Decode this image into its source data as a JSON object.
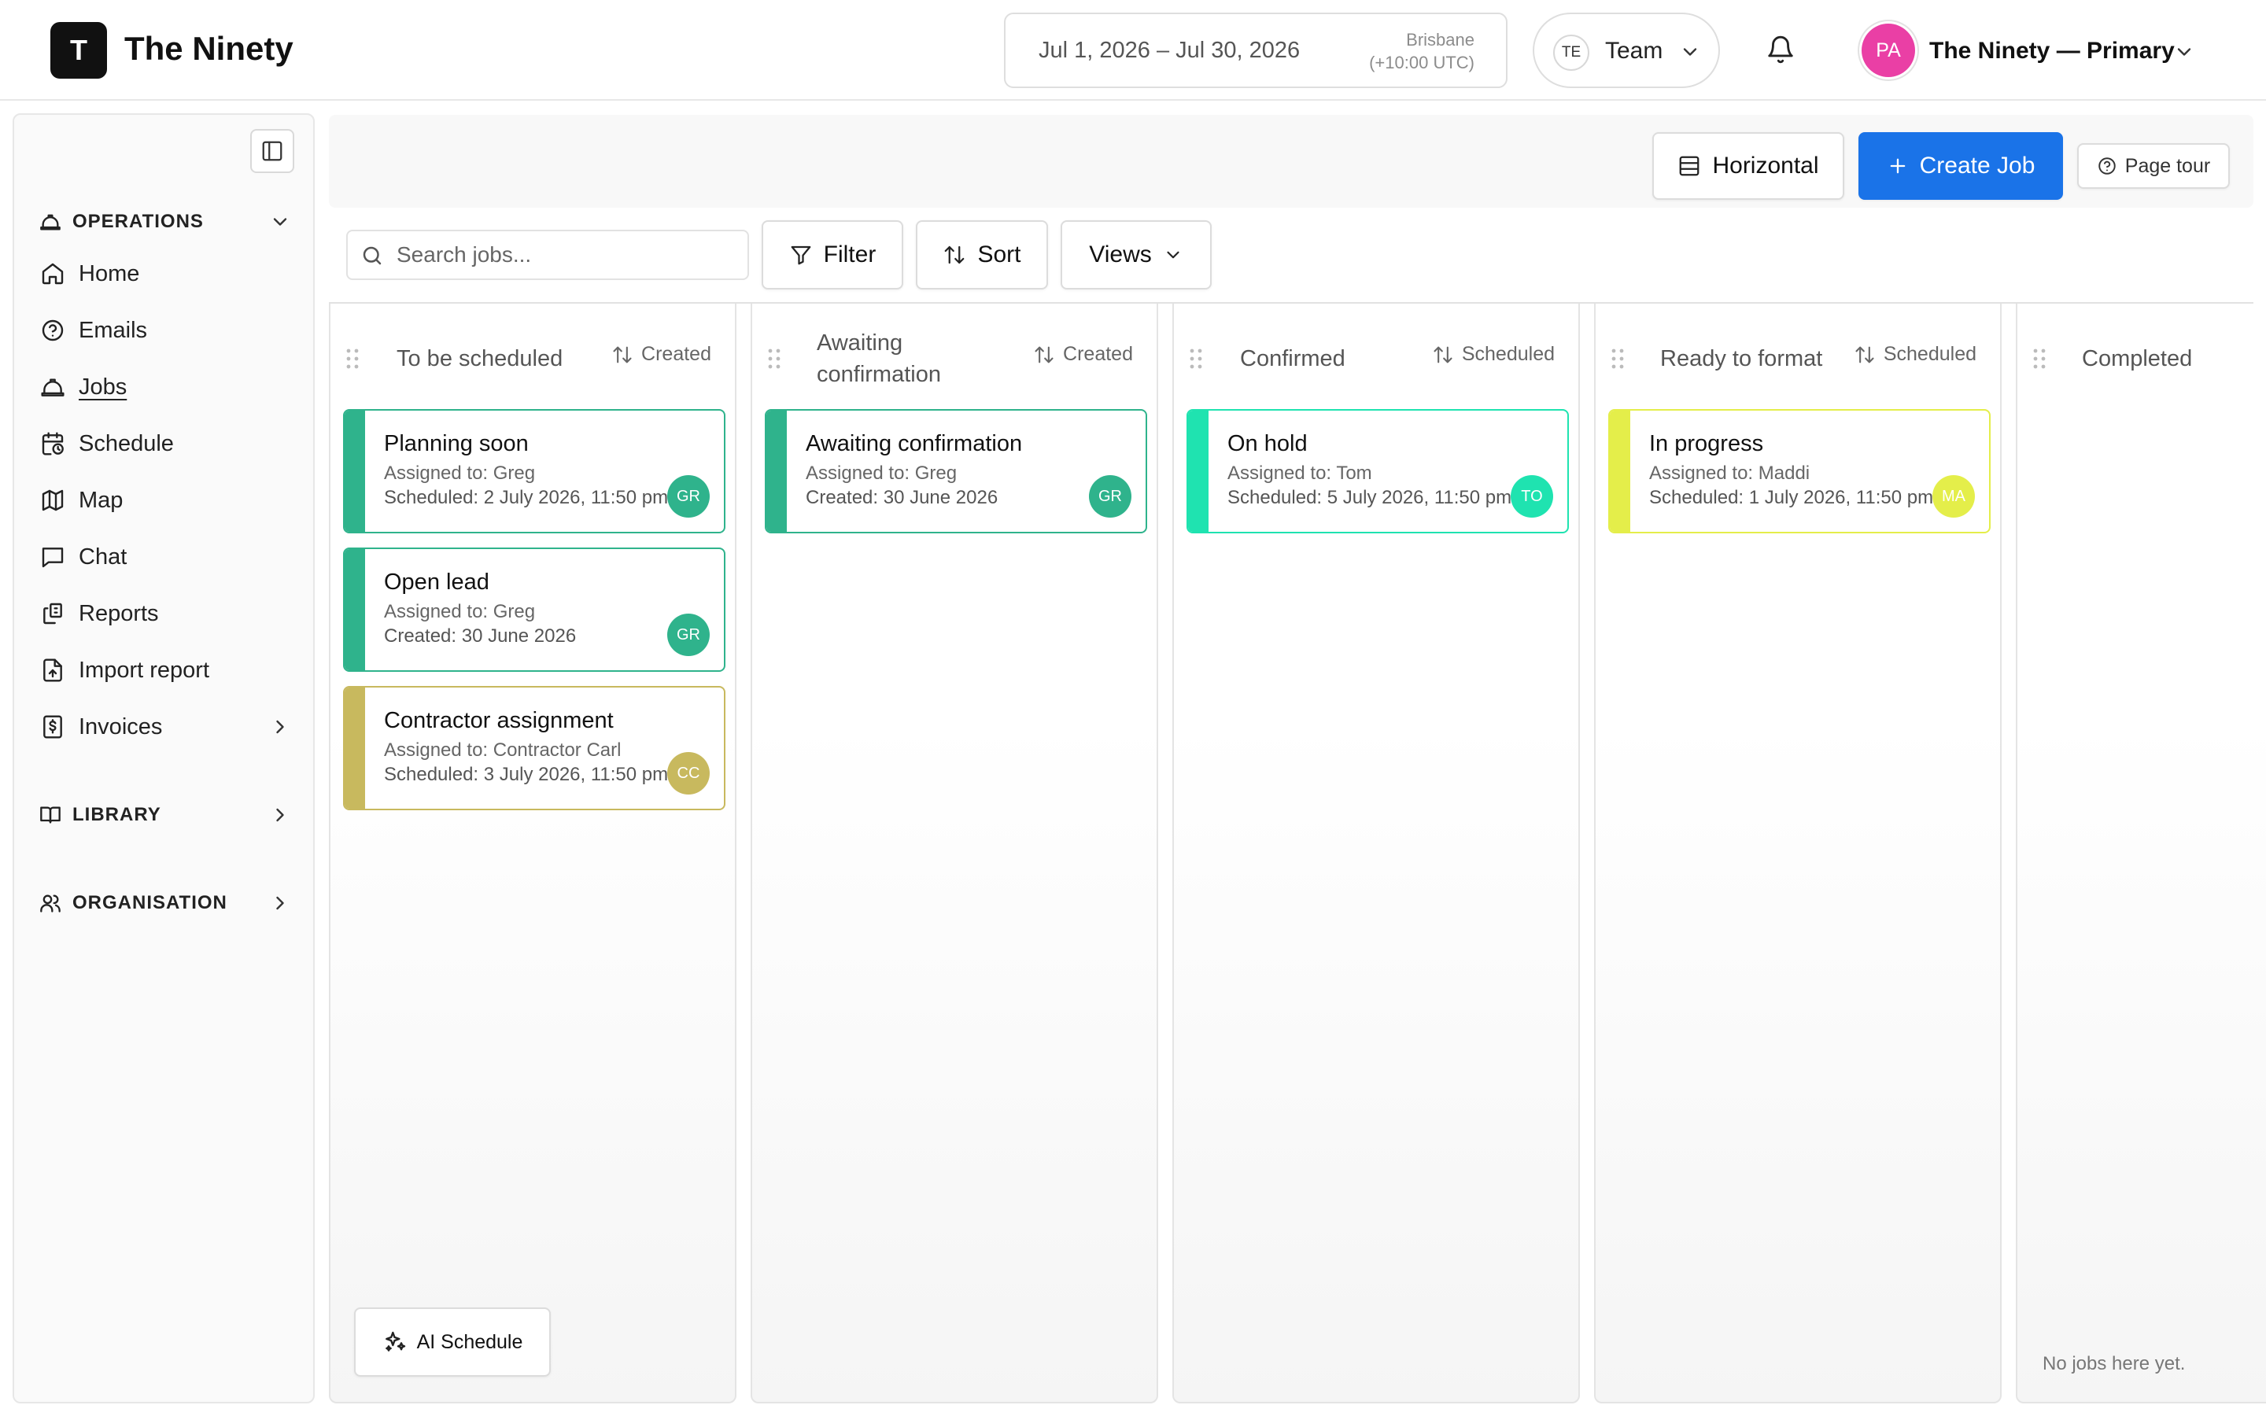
{
  "header": {
    "logo_letter": "T",
    "app_name": "The Ninety",
    "date_range": "Jul 1, 2026 – Jul 30, 2026",
    "timezone_city": "Brisbane",
    "timezone_offset": "(+10:00 UTC)",
    "team_initials": "TE",
    "team_label": "Team",
    "account_initials": "PA",
    "account_name": "The Ninety — Primary",
    "account_color": "#ea3fa5"
  },
  "sidebar": {
    "operations_label": "OPERATIONS",
    "items": [
      {
        "label": "Home",
        "icon": "home-icon"
      },
      {
        "label": "Emails",
        "icon": "help-circle-icon"
      },
      {
        "label": "Jobs",
        "icon": "hard-hat-icon"
      },
      {
        "label": "Schedule",
        "icon": "calendar-clock-icon"
      },
      {
        "label": "Map",
        "icon": "map-icon"
      },
      {
        "label": "Chat",
        "icon": "chat-icon"
      },
      {
        "label": "Reports",
        "icon": "reports-icon"
      },
      {
        "label": "Import report",
        "icon": "file-import-icon"
      },
      {
        "label": "Invoices",
        "icon": "invoice-icon"
      }
    ],
    "library_label": "LIBRARY",
    "organisation_label": "ORGANISATION"
  },
  "toolbar": {
    "horizontal_label": "Horizontal",
    "create_job_label": "Create Job",
    "page_tour_label": "Page tour",
    "search_placeholder": "Search jobs...",
    "filter_label": "Filter",
    "sort_label": "Sort",
    "views_label": "Views",
    "accent_color": "#1a73e8"
  },
  "columns": [
    {
      "title": "To be scheduled",
      "sort_label": "Created",
      "cards": [
        {
          "title": "Planning soon",
          "assigned": "Assigned to: Greg",
          "date": "Scheduled: 2 July 2026, 11:50 pm",
          "initials": "GR",
          "color": "#2fb38c"
        },
        {
          "title": "Open lead",
          "assigned": "Assigned to: Greg",
          "date": "Created: 30 June 2026",
          "initials": "GR",
          "color": "#2fb38c"
        },
        {
          "title": "Contractor assignment",
          "assigned": "Assigned to: Contractor Carl",
          "date": "Scheduled: 3 July 2026, 11:50 pm",
          "initials": "CC",
          "color": "#c8b95e"
        }
      ]
    },
    {
      "title": "Awaiting confirmation",
      "title_line1": "Awaiting",
      "title_line2": "confirmation",
      "sort_label": "Created",
      "cards": [
        {
          "title": "Awaiting confirmation",
          "assigned": "Assigned to: Greg",
          "date": "Created: 30 June 2026",
          "initials": "GR",
          "color": "#2fb38c"
        }
      ]
    },
    {
      "title": "Confirmed",
      "sort_label": "Scheduled",
      "cards": [
        {
          "title": "On hold",
          "assigned": "Assigned to: Tom",
          "date": "Scheduled: 5 July 2026, 11:50 pm",
          "initials": "TO",
          "color": "#1fe3b0"
        }
      ]
    },
    {
      "title": "Ready to format",
      "sort_label": "Scheduled",
      "cards": [
        {
          "title": "In progress",
          "assigned": "Assigned to: Maddi",
          "date": "Scheduled: 1 July 2026, 11:50 pm",
          "initials": "MA",
          "color": "#e4ee4a"
        }
      ]
    },
    {
      "title": "Completed",
      "empty_text": "No jobs here yet.",
      "cards": []
    }
  ],
  "ai_schedule_label": "AI Schedule"
}
